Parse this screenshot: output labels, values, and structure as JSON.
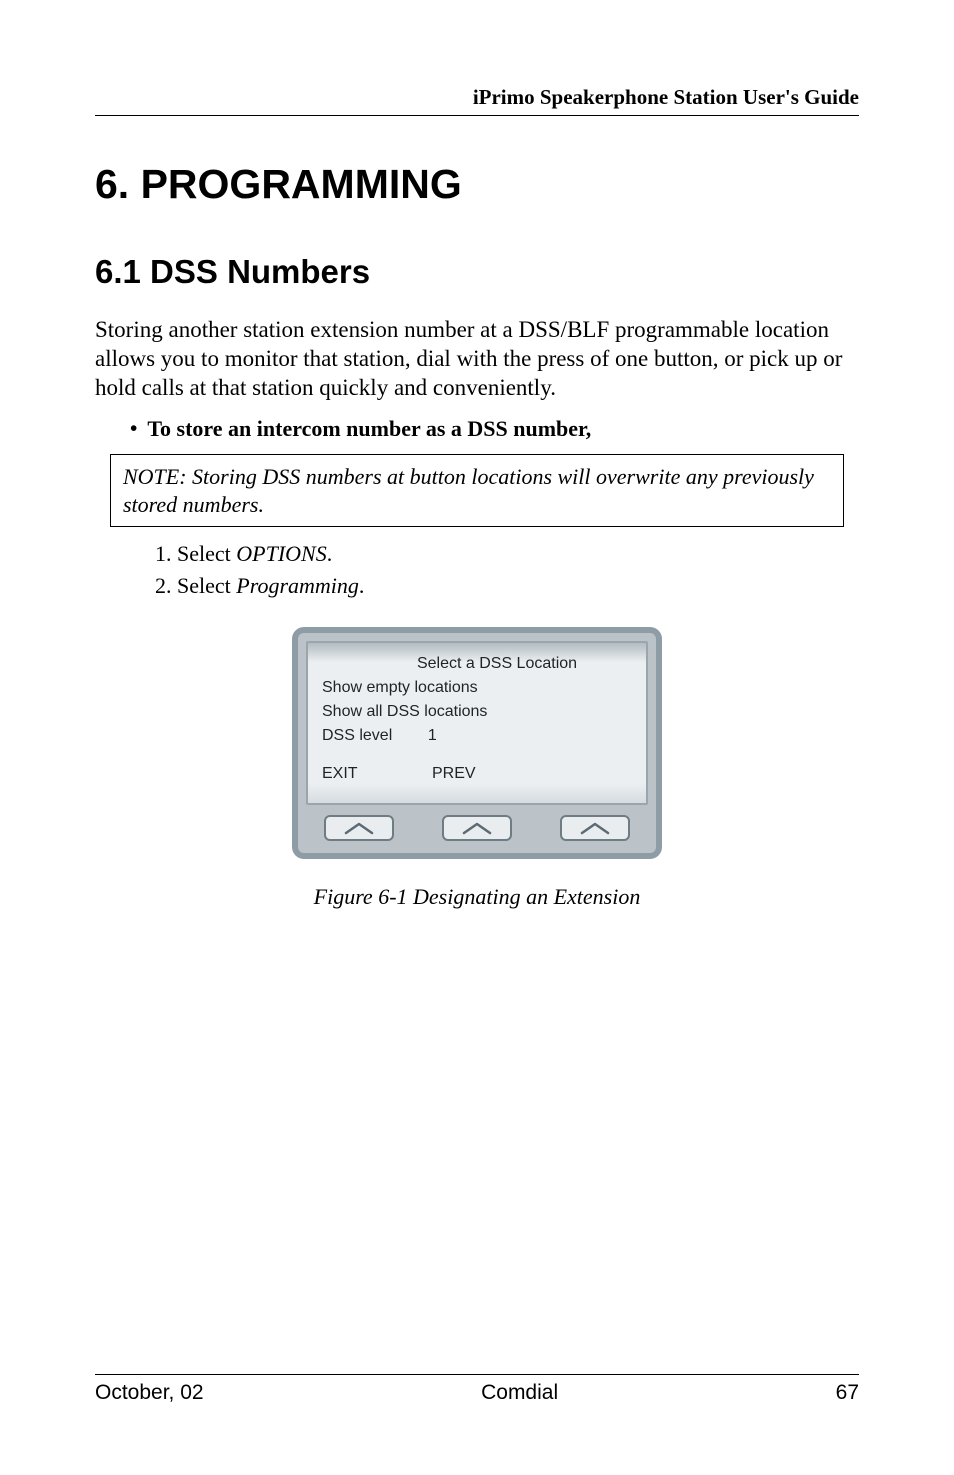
{
  "header": {
    "running_title": "iPrimo Speakerphone Station User's Guide"
  },
  "chapter": {
    "title": "6.  PROGRAMMING"
  },
  "section": {
    "title": "6.1  DSS Numbers",
    "intro_para": "Storing another station extension number at a DSS/BLF programmable location allows you to monitor that station, dial with the press of one button, or pick up or hold calls at that station quickly and conveniently.",
    "bullet_label": "To store an intercom number as a DSS number,",
    "note": "NOTE:  Storing DSS numbers at button locations will overwrite any previously stored numbers.",
    "steps": {
      "one_prefix": "1.  Select  ",
      "one_value": "OPTIONS",
      "one_suffix": ".",
      "two_prefix": "2.  Select  ",
      "two_value": "Programming",
      "two_suffix": "."
    }
  },
  "lcd": {
    "title": "Select a DSS Location",
    "line1": "Show empty locations",
    "line2": "Show all DSS locations",
    "line3_label": "DSS level",
    "line3_value": "1",
    "btn_exit": "EXIT",
    "btn_prev": "PREV"
  },
  "figure_caption": "Figure 6-1  Designating an Extension",
  "footer": {
    "left": "October, 02",
    "center": "Comdial",
    "right": "67"
  }
}
